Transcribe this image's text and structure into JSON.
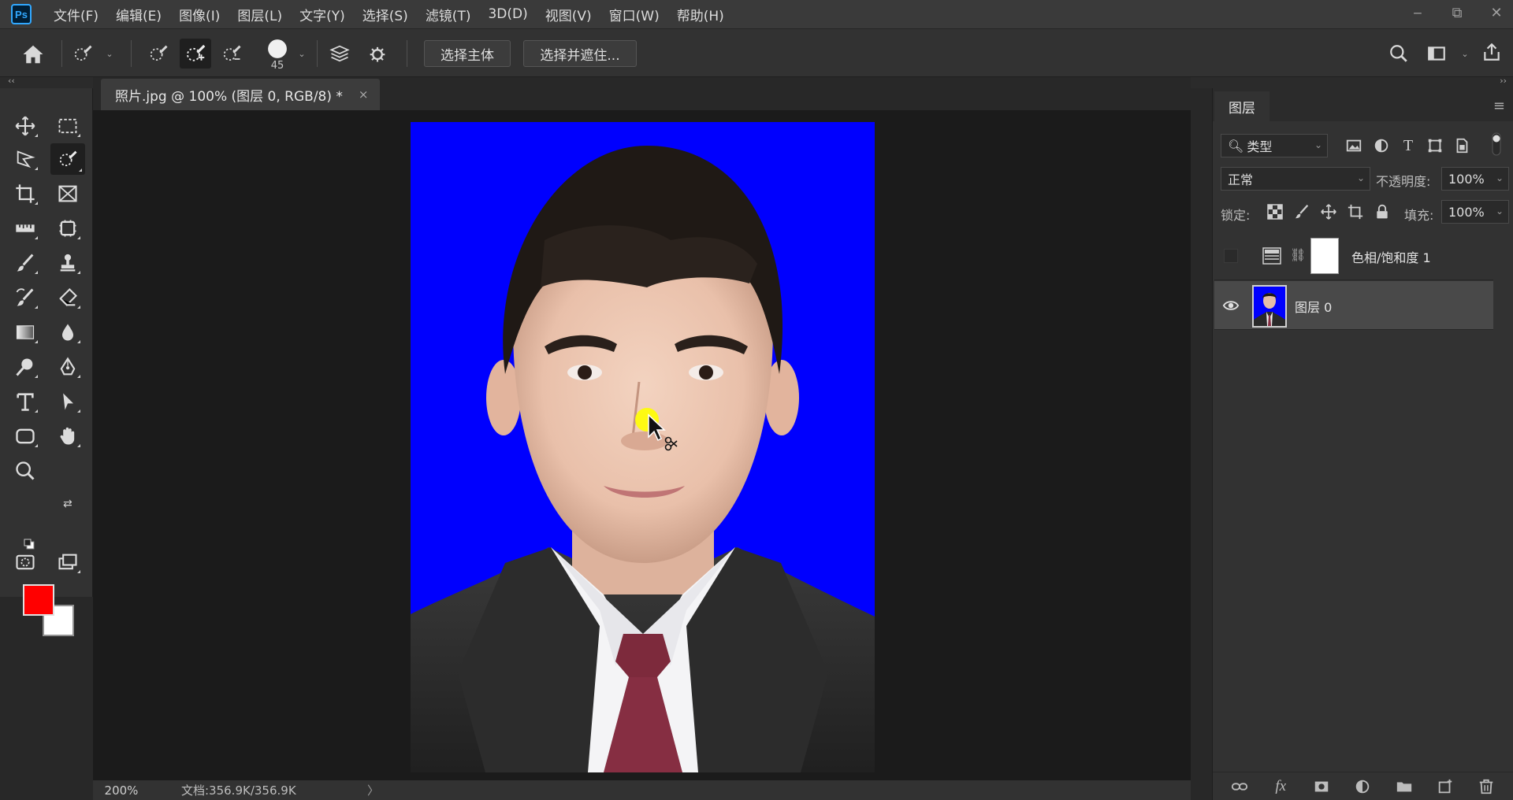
{
  "app": {
    "logo": "Ps"
  },
  "menu": [
    "文件(F)",
    "编辑(E)",
    "图像(I)",
    "图层(L)",
    "文字(Y)",
    "选择(S)",
    "滤镜(T)",
    "3D(D)",
    "视图(V)",
    "窗口(W)",
    "帮助(H)"
  ],
  "window_controls": {
    "minimize": "‒",
    "restore": "⧉",
    "close": "✕"
  },
  "options": {
    "brush_size": "45",
    "select_subject": "选择主体",
    "select_and_mask": "选择并遮住..."
  },
  "collapse_left": "‹‹",
  "collapse_right": "››",
  "document": {
    "tab_title": "照片.jpg @ 100% (图层 0, RGB/8) *",
    "close": "×"
  },
  "status": {
    "zoom": "200%",
    "doc_info": "文档:356.9K/356.9K",
    "arrow": "〉"
  },
  "colors": {
    "foreground": "#ff0000",
    "background": "#ffffff",
    "photo_bg": "#0000fe",
    "cursor_highlight": "#ffff00"
  },
  "layers_panel": {
    "tab": "图层",
    "filter_type": "类型",
    "blend_mode": "正常",
    "opacity_label": "不透明度:",
    "opacity_value": "100%",
    "lock_label": "锁定:",
    "fill_label": "填充:",
    "fill_value": "100%",
    "layers": [
      {
        "name": "色相/饱和度 1",
        "visible": false
      },
      {
        "name": "图层 0",
        "visible": true,
        "selected": true
      }
    ]
  }
}
